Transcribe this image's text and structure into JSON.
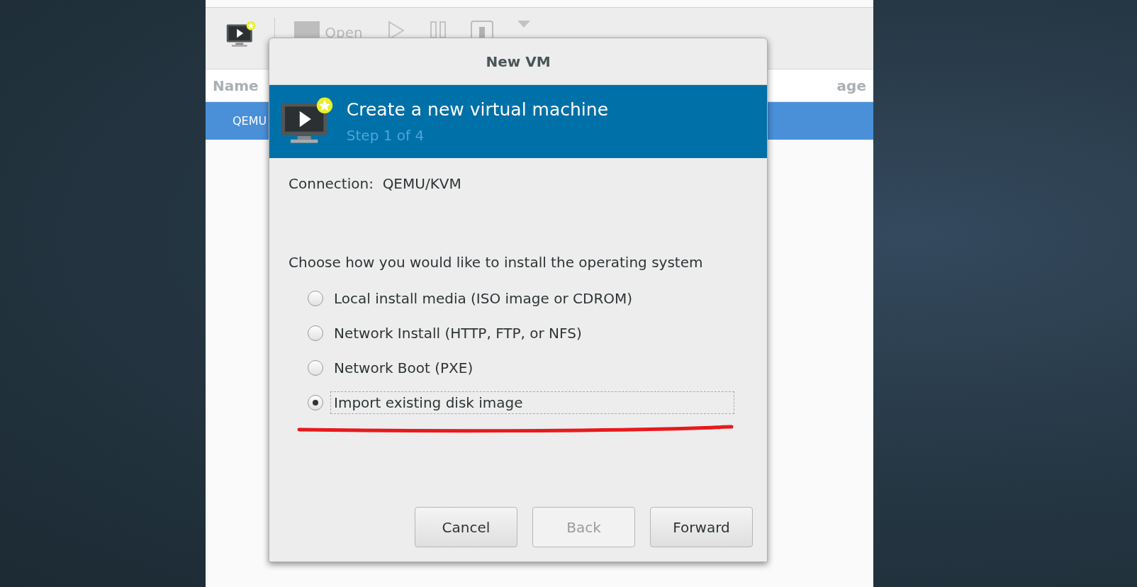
{
  "main_window": {
    "toolbar": [
      {
        "kind": "new",
        "disabled": false
      },
      {
        "kind": "open",
        "label": "Open",
        "disabled": true
      },
      {
        "kind": "run",
        "disabled": true
      },
      {
        "kind": "pause",
        "disabled": true
      },
      {
        "kind": "shutdown",
        "disabled": true
      },
      {
        "kind": "menu",
        "disabled": true
      }
    ],
    "table": {
      "columns": [
        "Name",
        "age"
      ],
      "rows": [
        {
          "name": "QEMU",
          "selected": true
        }
      ]
    }
  },
  "dialog": {
    "title": "New VM",
    "header": {
      "title": "Create a new virtual machine",
      "step": "Step 1 of 4"
    },
    "connection": {
      "label": "Connection:",
      "value": "QEMU/KVM"
    },
    "prompt": "Choose how you would like to install the operating system",
    "options": [
      {
        "label": "Local install media (ISO image or CDROM)",
        "selected": false
      },
      {
        "label": "Network Install (HTTP, FTP, or NFS)",
        "selected": false
      },
      {
        "label": "Network Boot (PXE)",
        "selected": false
      },
      {
        "label": "Import existing disk image",
        "selected": true
      }
    ],
    "buttons": [
      {
        "label": "Cancel",
        "disabled": false
      },
      {
        "label": "Back",
        "disabled": true
      },
      {
        "label": "Forward",
        "disabled": false
      }
    ]
  }
}
